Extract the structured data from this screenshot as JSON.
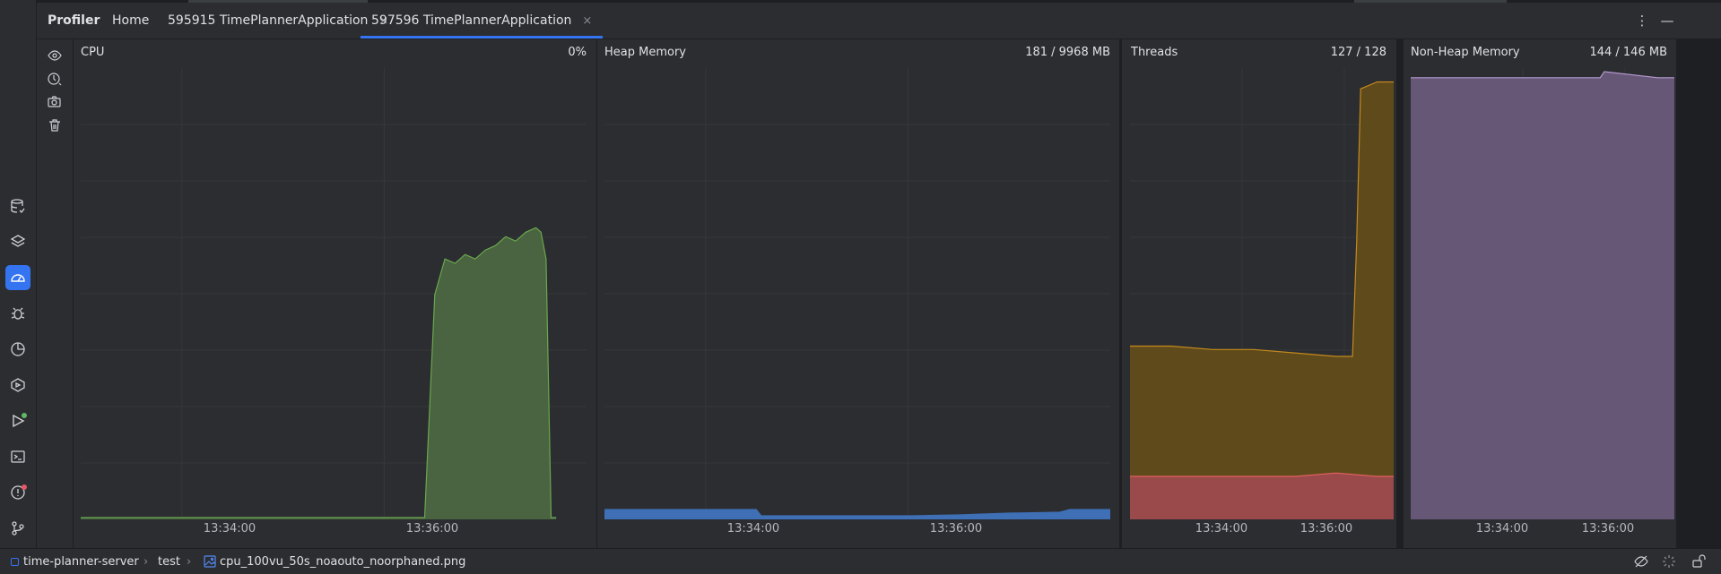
{
  "tabbar": {
    "title": "Profiler",
    "tabs": [
      {
        "label": "Home"
      },
      {
        "label": "595915 TimePlannerApplication",
        "close": "×"
      },
      {
        "label": "597596 TimePlannerApplication",
        "close": "×",
        "active": true
      }
    ],
    "more_icon": "more-vertical-icon",
    "minimize_icon": "minimize-icon"
  },
  "colors": {
    "accent": "#3574f0",
    "cpu_fill": "#4a6340",
    "cpu_line": "#6aa84f",
    "heap_fill": "#3f6fb5",
    "threads_fill": "#5f4a1c",
    "threads_line": "#c48a1c",
    "threads_daemon_fill": "#9a4a4a",
    "threads_daemon_line": "#e06060",
    "nonheap_fill": "#675776",
    "nonheap_line": "#b59ad2"
  },
  "panels": {
    "cpu": {
      "title": "CPU",
      "value": "0%"
    },
    "heap": {
      "title": "Heap Memory",
      "value": "181 / 9968 MB"
    },
    "threads": {
      "title": "Threads",
      "value": "127 / 128"
    },
    "nonheap": {
      "title": "Non-Heap Memory",
      "value": "144 / 146 MB"
    }
  },
  "tools": [
    "eye-icon",
    "timer-icon",
    "camera-icon",
    "trash-icon"
  ],
  "left_toolbar": [
    "database-icon",
    "layers-icon",
    "profiler-icon",
    "bug-icon",
    "pie-icon",
    "services-icon",
    "run-icon",
    "terminal-icon",
    "problems-icon",
    "git-icon"
  ],
  "statusbar": {
    "crumbs": [
      "time-planner-server",
      "test",
      "cpu_100vu_50s_noaouto_noorphaned.png"
    ],
    "right_icons": [
      "hide-icon",
      "loader-icon",
      "lock-icon"
    ]
  },
  "chart_data": [
    {
      "type": "area",
      "title": "CPU",
      "value_label": "0%",
      "xticks": [
        "13:34:00",
        "13:36:00"
      ],
      "ylim": [
        0,
        100
      ],
      "x_minutes": [
        0,
        1,
        2,
        3,
        3.4,
        3.5,
        3.6,
        3.7,
        3.8,
        3.9,
        4.0,
        4.1,
        4.2,
        4.3,
        4.4,
        4.5,
        4.55,
        4.6,
        4.65,
        4.7
      ],
      "values": [
        0,
        0,
        0,
        0,
        0,
        50,
        58,
        57,
        59,
        58,
        60,
        61,
        63,
        62,
        64,
        65,
        64,
        58,
        0,
        0
      ]
    },
    {
      "type": "area",
      "title": "Heap Memory",
      "value_label": "181 / 9968 MB",
      "xticks": [
        "13:34:00",
        "13:36:00"
      ],
      "ylim": [
        0,
        9968
      ],
      "x_minutes": [
        0,
        1.5,
        1.55,
        3.0,
        3.5,
        4.0,
        4.5,
        4.6,
        5.0
      ],
      "values": [
        181,
        181,
        40,
        40,
        60,
        100,
        120,
        181,
        181
      ]
    },
    {
      "type": "area",
      "title": "Threads",
      "value_label": "127 / 128",
      "xticks": [
        "13:34:00",
        "13:36:00"
      ],
      "ylim": [
        0,
        130
      ],
      "series": [
        {
          "x_minutes": [
            0,
            0.5,
            1.0,
            1.5,
            2.0,
            2.5,
            2.7,
            2.75,
            2.8,
            3.0,
            3.2
          ],
          "values": [
            50,
            50,
            49,
            49,
            48,
            47,
            47,
            80,
            125,
            127,
            127
          ]
        },
        {
          "x_minutes": [
            0,
            1.0,
            2.0,
            2.5,
            3.0,
            3.2
          ],
          "values": [
            12,
            12,
            12,
            13,
            12,
            12
          ]
        }
      ]
    },
    {
      "type": "area",
      "title": "Non-Heap Memory",
      "value_label": "144 / 146 MB",
      "xticks": [
        "13:34:00",
        "13:36:00"
      ],
      "ylim": [
        0,
        146
      ],
      "x_minutes": [
        0,
        1.0,
        2.0,
        2.3,
        2.35,
        3.0,
        3.2
      ],
      "values": [
        144,
        144,
        144,
        144,
        146,
        144,
        144
      ]
    }
  ]
}
